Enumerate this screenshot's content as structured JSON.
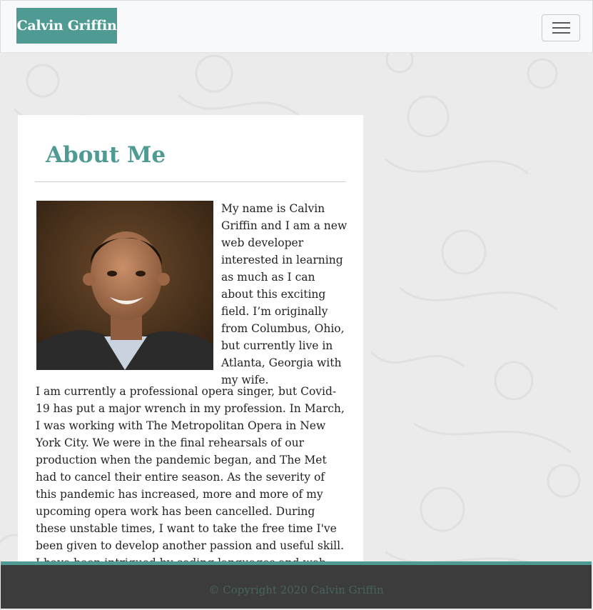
{
  "navbar": {
    "brand": "Calvin Griffin",
    "toggle_icon": "hamburger-menu-icon"
  },
  "about": {
    "heading": "About Me",
    "photo_alt": "Portrait of Calvin Griffin",
    "paragraph1": "My name is Calvin Griffin and I am a new web developer interested in learning as much as I can about this exciting field. I’m originally from Columbus, Ohio, but currently live in Atlanta, Georgia with my wife.",
    "paragraph2": "I am currently a professional opera singer, but Covid-19 has put a major wrench in my profession. In March, I was working with The Metropolitan Opera in New York City. We were in the final rehearsals of our production when the pandemic began, and The Met had to cancel their entire season. As the severity of this pandemic has increased, more and more of my upcoming opera work has been cancelled. During these unstable times, I want to take the free time I've been given to develop another passion and useful skill. I have been intrigued by coding languages and web development, so I enrolled in GA Tech's Full Stack Web Development"
  },
  "footer": {
    "copyright": "© Copyright 2020 Calvin Griffin"
  },
  "colors": {
    "accent": "#4f9a93",
    "footer_bg": "#3c3c3c",
    "page_bg": "#ebebeb"
  }
}
